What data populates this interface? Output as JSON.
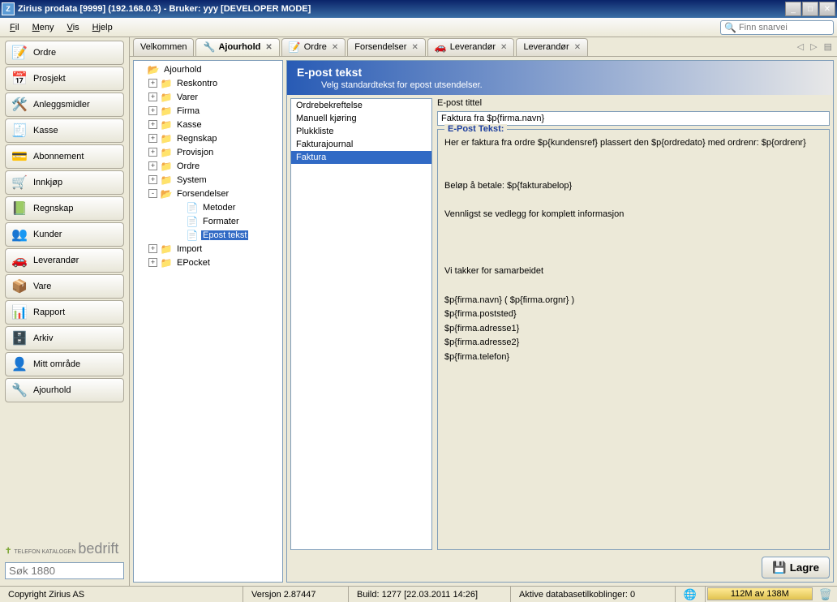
{
  "title": "Zirius prodata [9999] (192.168.0.3)  - Bruker: yyy [DEVELOPER MODE]",
  "menu": {
    "fil": "Fil",
    "meny": "Meny",
    "vis": "Vis",
    "hjelp": "Hjelp"
  },
  "search_placeholder": "Finn snarvei",
  "navbar": [
    {
      "label": "Ordre",
      "icon": "📝"
    },
    {
      "label": "Prosjekt",
      "icon": "📅"
    },
    {
      "label": "Anleggsmidler",
      "icon": "🛠️"
    },
    {
      "label": "Kasse",
      "icon": "🧾"
    },
    {
      "label": "Abonnement",
      "icon": "💳"
    },
    {
      "label": "Innkjøp",
      "icon": "🛒"
    },
    {
      "label": "Regnskap",
      "icon": "📗"
    },
    {
      "label": "Kunder",
      "icon": "👥"
    },
    {
      "label": "Leverandør",
      "icon": "🚗"
    },
    {
      "label": "Vare",
      "icon": "📦"
    },
    {
      "label": "Rapport",
      "icon": "📊"
    },
    {
      "label": "Arkiv",
      "icon": "🗄️"
    },
    {
      "label": "Mitt område",
      "icon": "👤"
    },
    {
      "label": "Ajourhold",
      "icon": "🔧"
    }
  ],
  "tel_logo_a": "TELEFON KATALOGEN",
  "tel_logo_b": "bedrift",
  "sok_placeholder": "Søk 1880",
  "tabs": [
    {
      "label": "Velkommen",
      "icon": "",
      "closeable": false,
      "active": false
    },
    {
      "label": "Ajourhold",
      "icon": "🔧",
      "closeable": true,
      "active": true
    },
    {
      "label": "Ordre",
      "icon": "📝",
      "closeable": true,
      "active": false
    },
    {
      "label": "Forsendelser",
      "icon": "",
      "closeable": true,
      "active": false
    },
    {
      "label": "Leverandør",
      "icon": "🚗",
      "closeable": true,
      "active": false
    },
    {
      "label": "Leverandør",
      "icon": "",
      "closeable": true,
      "active": false
    }
  ],
  "tree": {
    "root": "Ajourhold",
    "children": [
      {
        "label": "Reskontro",
        "exp": "+"
      },
      {
        "label": "Varer",
        "exp": "+"
      },
      {
        "label": "Firma",
        "exp": "+"
      },
      {
        "label": "Kasse",
        "exp": "+"
      },
      {
        "label": "Regnskap",
        "exp": "+"
      },
      {
        "label": "Provisjon",
        "exp": "+"
      },
      {
        "label": "Ordre",
        "exp": "+"
      },
      {
        "label": "System",
        "exp": "+"
      },
      {
        "label": "Forsendelser",
        "exp": "-",
        "open": true,
        "children": [
          {
            "label": "Metoder",
            "file": true
          },
          {
            "label": "Formater",
            "file": true
          },
          {
            "label": "Epost tekst",
            "file": true,
            "selected": true
          }
        ]
      },
      {
        "label": "Import",
        "exp": "+"
      },
      {
        "label": "EPocket",
        "exp": "+"
      }
    ]
  },
  "header": {
    "title": "E-post tekst",
    "subtitle": "Velg standardtekst for epost utsendelser."
  },
  "types": [
    "Ordrebekreftelse",
    "Manuell kjøring",
    "Plukkliste",
    "Fakturajournal",
    "Faktura"
  ],
  "type_selected": "Faktura",
  "title_label": "E-post tittel",
  "title_value": "Faktura fra $p{firma.navn}",
  "body_label": "E-Post Tekst:",
  "body_value": "Her er faktura fra ordre $p{kundensref} plassert den $p{ordredato} med ordrenr: $p{ordrenr}\n\n\nBeløp å betale: $p{fakturabelop}\n\nVennligst se vedlegg for komplett informasjon\n\n\n\nVi takker for samarbeidet\n\n$p{firma.navn} ( $p{firma.orgnr} )\n$p{firma.poststed}\n$p{firma.adresse1}\n$p{firma.adresse2}\n$p{firma.telefon}",
  "save_label": "Lagre",
  "status": {
    "copyright": "Copyright Zirius AS",
    "version": "Versjon 2.87447",
    "build": "Build: 1277 [22.03.2011 14:26]",
    "db": "Aktive databasetilkoblinger: 0",
    "mem": "112M av 138M"
  }
}
